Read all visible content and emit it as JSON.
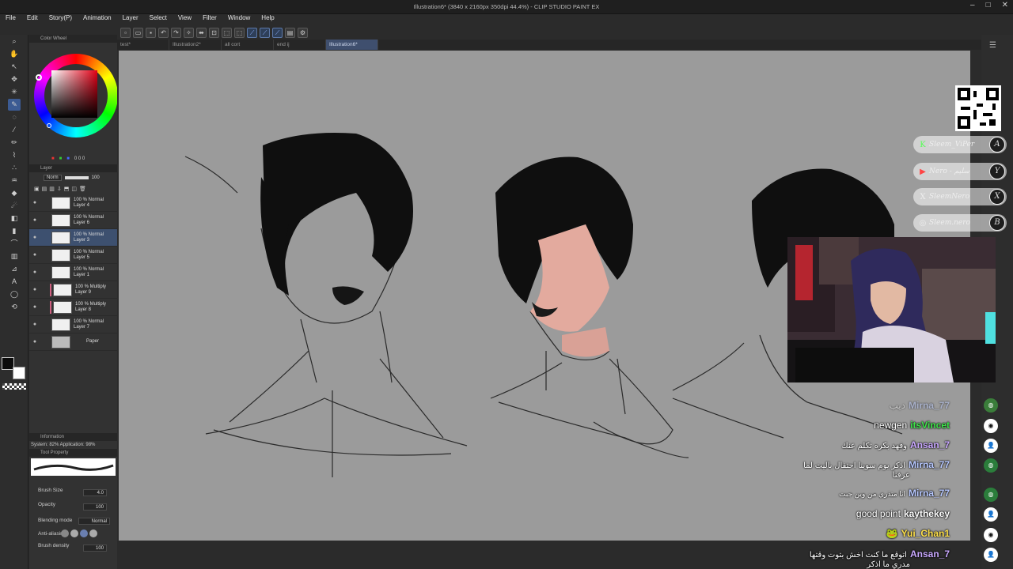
{
  "window": {
    "title": "Illustration6* (3840 x 2160px 350dpi 44.4%) - CLIP STUDIO PAINT EX"
  },
  "menu": [
    "File",
    "Edit",
    "Story(P)",
    "Animation",
    "Layer",
    "Select",
    "View",
    "Filter",
    "Window",
    "Help"
  ],
  "tabs": [
    {
      "label": "test*",
      "active": false
    },
    {
      "label": "Illustration2*",
      "active": false
    },
    {
      "label": "all cort",
      "active": false
    },
    {
      "label": "end ij",
      "active": false
    },
    {
      "label": "Illustration6*",
      "active": true
    }
  ],
  "color_panel": {
    "title": "Color Wheel",
    "main_color": "#0a0a0a",
    "sub_color": "#ffffff",
    "hue_color": "#e30016",
    "readout": "0  0  0"
  },
  "layer_panel": {
    "title": "Layer",
    "blend_mode": "Norm",
    "opacity": "100",
    "layers": [
      {
        "pct": "100 % Normal",
        "name": "Layer 4",
        "selected": false,
        "color_bar": false
      },
      {
        "pct": "100 % Normal",
        "name": "Layer 6",
        "selected": false,
        "color_bar": false
      },
      {
        "pct": "100 % Normal",
        "name": "Layer 3",
        "selected": true,
        "color_bar": false
      },
      {
        "pct": "100 % Normal",
        "name": "Layer 5",
        "selected": false,
        "color_bar": false
      },
      {
        "pct": "100 % Normal",
        "name": "Layer 1",
        "selected": false,
        "color_bar": false
      },
      {
        "pct": "100 % Multiply",
        "name": "Layer 9",
        "selected": false,
        "color_bar": true
      },
      {
        "pct": "100 % Multiply",
        "name": "Layer 8",
        "selected": false,
        "color_bar": true
      },
      {
        "pct": "100 % Normal",
        "name": "Layer 7",
        "selected": false,
        "color_bar": false
      },
      {
        "pct": "",
        "name": "Paper",
        "selected": false,
        "color_bar": false
      }
    ]
  },
  "info_panel": {
    "title": "Information",
    "text": "System: 82%  Application: 98%"
  },
  "tool_property": {
    "title": "Tool Property",
    "rows": [
      {
        "label": "Brush Size",
        "value": "4.0"
      },
      {
        "label": "Opacity",
        "value": "100"
      },
      {
        "label": "Blending mode",
        "value": "Normal"
      },
      {
        "label": "Anti-aliasing",
        "value": ""
      },
      {
        "label": "Brush density",
        "value": "100"
      }
    ]
  },
  "stream_overlay": {
    "socials": [
      {
        "icon": "K",
        "handle": "Sleem_ViPer",
        "letter": "A"
      },
      {
        "icon": "▶",
        "handle": "Nero - سليم",
        "letter": "Y"
      },
      {
        "icon": "X",
        "handle": "SleemNero",
        "letter": "X"
      },
      {
        "icon": "◎",
        "handle": "Sleem.nero",
        "letter": "B"
      }
    ],
    "chat": [
      {
        "user": "Mirna_77",
        "text": "ديب",
        "user_color": "#b7c8ff",
        "faded": true
      },
      {
        "user": "itsVincet",
        "text": "newgen",
        "user_color": "#3de34a",
        "faded": false
      },
      {
        "user": "Ansan_7",
        "text": "وفهد بكره تكلم عنك",
        "user_color": "#c9a8ff",
        "faded": false
      },
      {
        "user": "Mirna_77",
        "text": "اذكر يوم سوينا احتفال باليت لما",
        "text2": "عرفنا",
        "user_color": "#b7c8ff",
        "faded": false
      },
      {
        "user": "Mirna_77",
        "text": "انا متذري من وين جبت",
        "user_color": "#b7c8ff",
        "faded": false
      },
      {
        "user": "kaythekey",
        "text": "good point",
        "user_color": "#fff",
        "faded": false
      },
      {
        "user": "Yui_Chan1",
        "text": "",
        "user_color": "#ffe14a",
        "faded": false
      },
      {
        "user": "Ansan_7",
        "text": "اتوقع ما كنت اخش بتوت وقتها",
        "text2": "مدري ما اذكر",
        "user_color": "#c9a8ff",
        "faded": false
      }
    ]
  }
}
